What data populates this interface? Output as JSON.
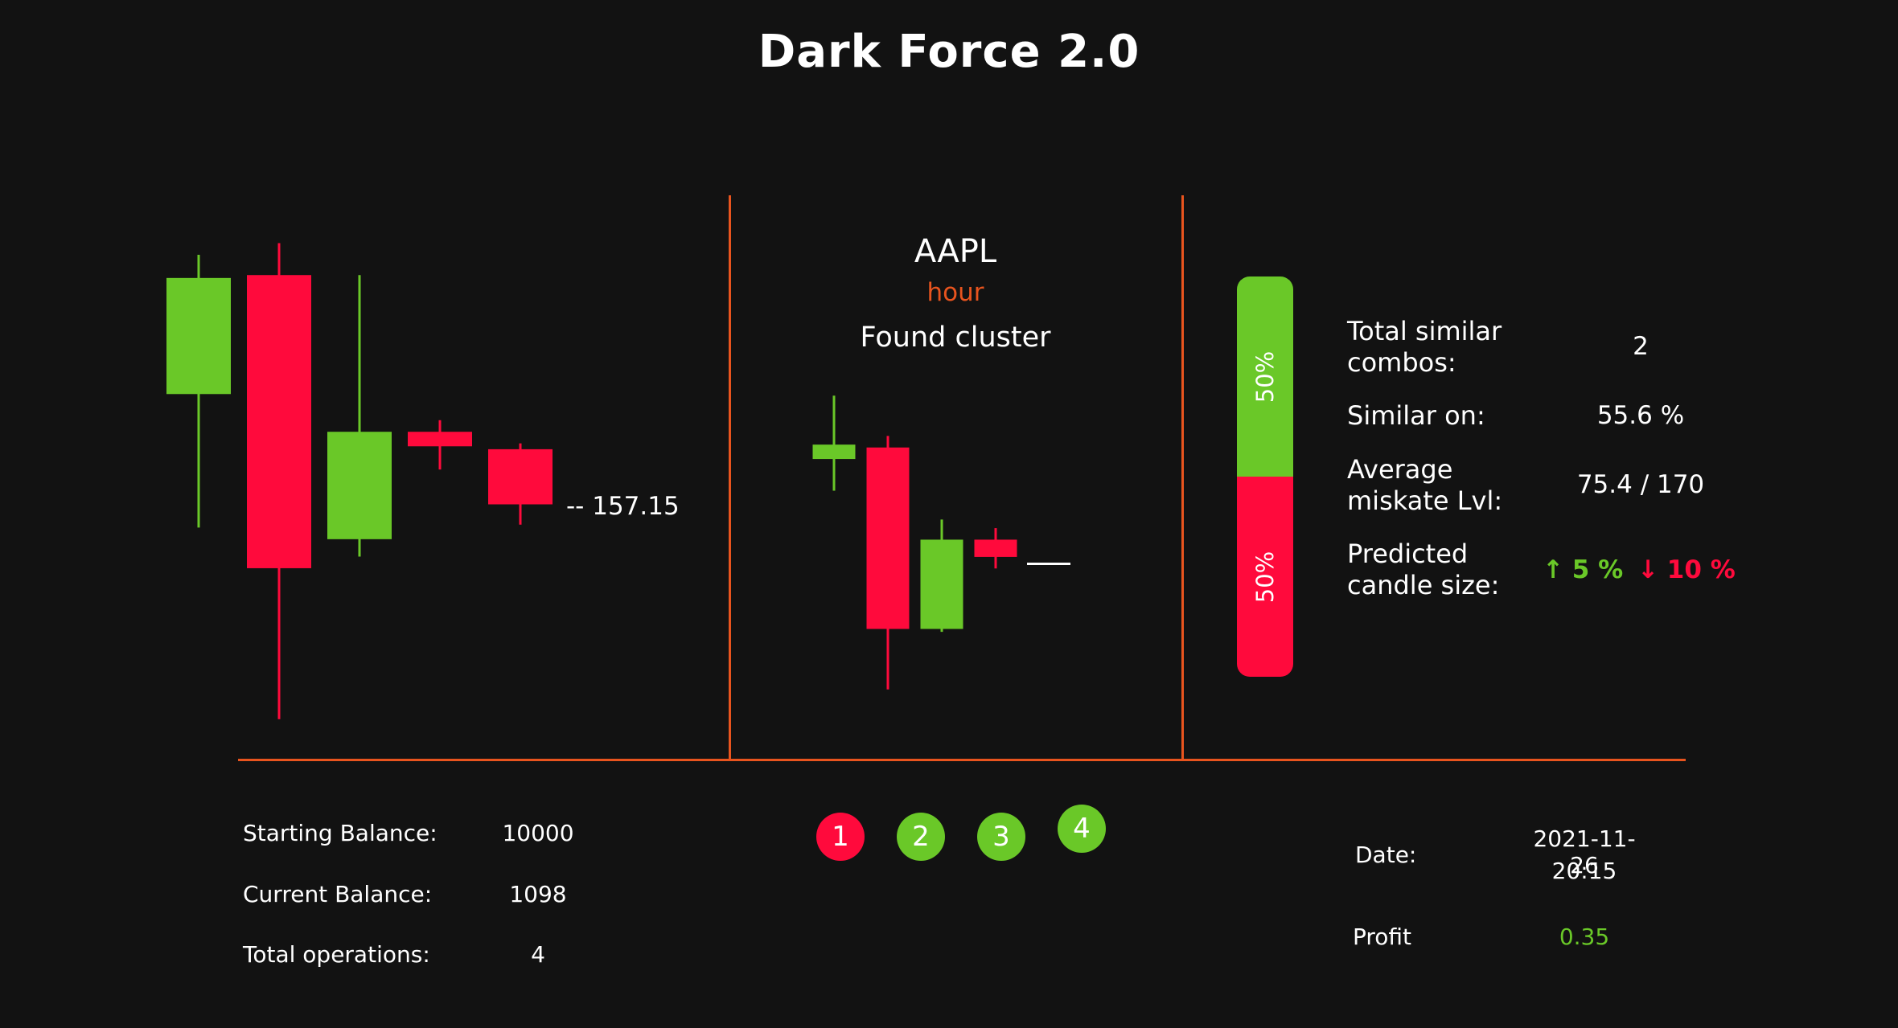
{
  "app": {
    "title": "Dark Force 2.0"
  },
  "colors": {
    "bull": "#6ac828",
    "bear": "#ff0a3c",
    "accent": "#e8541e",
    "background": "#121212"
  },
  "left_chart": {
    "candles": [
      {
        "open": 189,
        "close": 149,
        "high": 197,
        "low": 103,
        "dir": "up"
      },
      {
        "open": 190,
        "close": 89,
        "high": 201,
        "low": 37,
        "dir": "down"
      },
      {
        "open": 99,
        "close": 136,
        "high": 190,
        "low": 93,
        "dir": "up"
      },
      {
        "open": 136,
        "close": 131,
        "high": 140,
        "low": 123,
        "dir": "down"
      },
      {
        "open": 130,
        "close": 111,
        "high": 132,
        "low": 104,
        "dir": "down"
      }
    ],
    "last_price": "-- 157.15"
  },
  "cluster": {
    "ticker": "AAPL",
    "timeframe": "hour",
    "label": "Found cluster",
    "candles": [
      {
        "open": 189,
        "close": 194,
        "high": 211,
        "low": 178,
        "dir": "up"
      },
      {
        "open": 193,
        "close": 130,
        "high": 197,
        "low": 109,
        "dir": "down"
      },
      {
        "open": 130,
        "close": 161,
        "high": 168,
        "low": 129,
        "dir": "up"
      },
      {
        "open": 161,
        "close": 155,
        "high": 165,
        "low": 151,
        "dir": "down"
      }
    ]
  },
  "prediction_bar": {
    "up_percent": 50,
    "down_percent": 50,
    "up_label": "50%",
    "down_label": "50%"
  },
  "stats": {
    "total_similar_label": "Total similar combos:",
    "total_similar_value": "2",
    "similar_on_label": "Similar on:",
    "similar_on_value": "55.6 %",
    "avg_mistake_label": "Average miskate Lvl:",
    "avg_mistake_value": "75.4 / 170",
    "predicted_label": "Predicted candle size:",
    "predicted_up": "↑ 5 %",
    "predicted_down": "↓ 10 %"
  },
  "balance": {
    "starting_label": "Starting Balance:",
    "starting_value": "10000",
    "current_label": "Current Balance:",
    "current_value": "1098",
    "ops_label": "Total operations:",
    "ops_value": "4"
  },
  "operations": [
    {
      "label": "1",
      "color": "#ff0a3c"
    },
    {
      "label": "2",
      "color": "#6ac828"
    },
    {
      "label": "3",
      "color": "#6ac828"
    },
    {
      "label": "4",
      "color": "#6ac828"
    }
  ],
  "info": {
    "date_label": "Date:",
    "date_value": "2021-11-26",
    "time_value": "20:15",
    "profit_label": "Profit",
    "profit_value": "0.35"
  }
}
